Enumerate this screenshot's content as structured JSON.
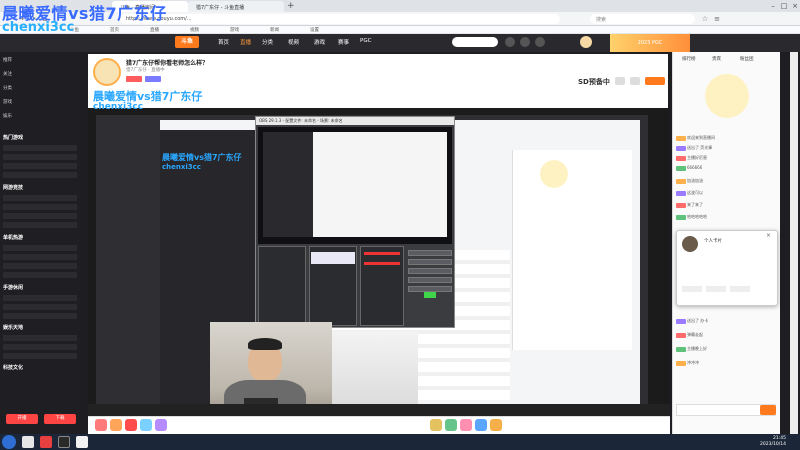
{
  "overlay": {
    "line1": "晨曦爱情vs猎7广东仔",
    "line2": "chenxi3cc",
    "line3": "晨曦爱情vs猎7广东仔",
    "line4": "chenxi3cc",
    "line5": "晨曦爱情vs猎7广东仔",
    "line6": "chenxi3cc"
  },
  "browser": {
    "tab1": "斗鱼 - 直播房间",
    "tab2": "猎7广东仔 - 斗鱼直播",
    "new_tab": "+",
    "url": "https://www.douyu.com/...",
    "search_placeholder": "搜索",
    "bookmarks": [
      "斗鱼",
      "首页",
      "直播",
      "视频",
      "游戏",
      "新闻",
      "设置"
    ]
  },
  "header": {
    "logo": "斗鱼",
    "nav": [
      "首页",
      "直播",
      "分类",
      "视频",
      "游戏",
      "赛事",
      "PGC"
    ],
    "banner": "2023 PGC"
  },
  "sidebar": {
    "items": [
      "推荐",
      "关注",
      "分类",
      "游戏",
      "娱乐",
      "赛事"
    ],
    "sections": [
      "热门游戏",
      "网游竞技",
      "单机热游",
      "手游休闲",
      "娱乐天地",
      "科技文化"
    ],
    "buttons": [
      "开播",
      "下载"
    ]
  },
  "stream": {
    "title": "猎7广东仔帮你看老师怎么样？",
    "subtitle": "猎7广东仔 · 直播中",
    "sd_label": "SD预备中"
  },
  "obs": {
    "title": "OBS 29.1.3 - 配置文件: 未命名 - 场景: 未命名"
  },
  "chat": {
    "tabs": [
      "排行榜",
      "贵宾",
      "粉丝团"
    ],
    "lines": [
      "欢迎来到直播间",
      "送出了 荧光棒",
      "主播好厉害",
      "666666",
      "加油加油",
      "这波可以",
      "来了来了",
      "哈哈哈哈哈",
      "送出了 办卡",
      "弹幕走起",
      "主播晚上好",
      "冲冲冲"
    ],
    "popup_title": "个人卡片"
  },
  "taskbar": {
    "clock_time": "21:45",
    "clock_date": "2023/10/14"
  },
  "colors": {
    "accent": "#ff7a1c",
    "overlay_blue": "#2aa7ff",
    "dark_bg": "#1f1f23"
  }
}
